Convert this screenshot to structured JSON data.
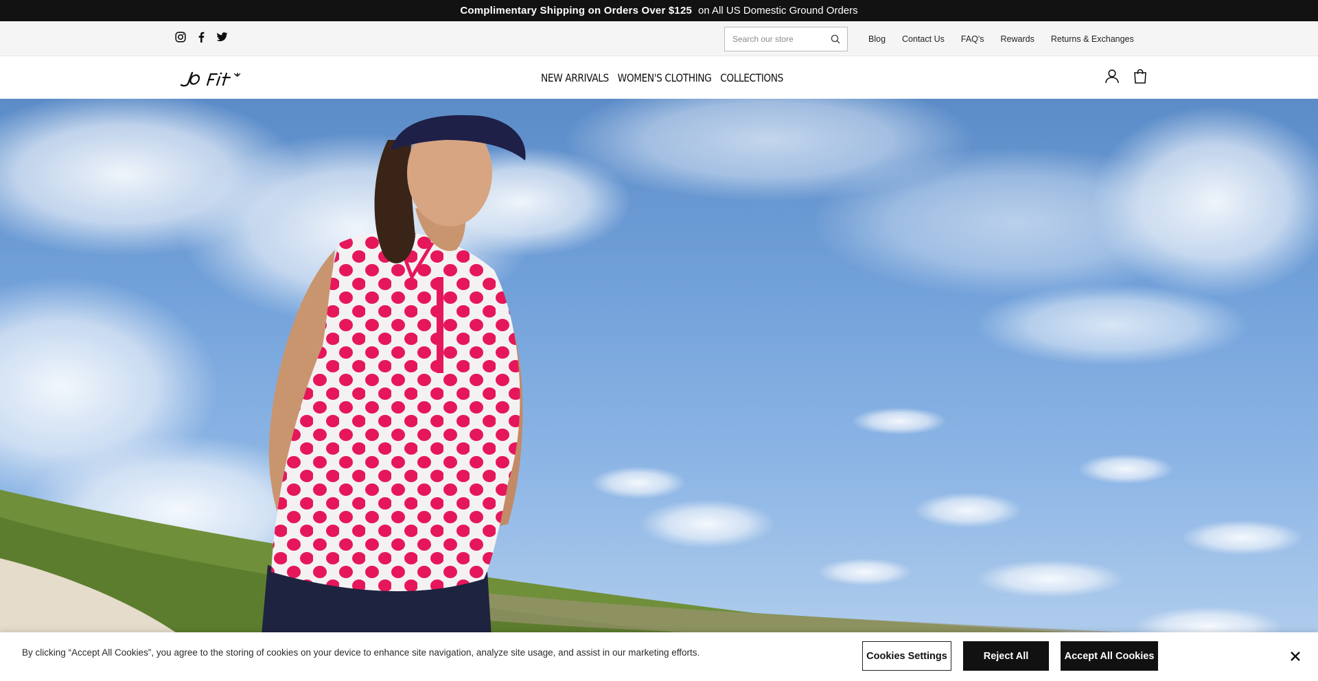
{
  "announcement": {
    "bold": "Complimentary Shipping on Orders Over $125",
    "rest": "on All US Domestic Ground Orders"
  },
  "social": {
    "icons": [
      "instagram-icon",
      "facebook-icon",
      "twitter-icon"
    ]
  },
  "search": {
    "placeholder": "Search our store"
  },
  "utility_links": [
    "Blog",
    "Contact Us",
    "FAQ's",
    "Rewards",
    "Returns & Exchanges"
  ],
  "brand": {
    "logo_text": "Jofit"
  },
  "main_nav": [
    "NEW ARRIVALS",
    "WOMEN'S CLOTHING",
    "COLLECTIONS"
  ],
  "header_icons": [
    "account-icon",
    "cart-icon"
  ],
  "cookie": {
    "text": "By clicking “Accept All Cookies”, you agree to the storing of cookies on your device to enhance site navigation, analyze site usage, and assist in our marketing efforts.",
    "settings_label": "Cookies Settings",
    "reject_label": "Reject All",
    "accept_label": "Accept All Cookies"
  },
  "colors": {
    "announcement_bg": "#121212",
    "utility_bg": "#f5f5f5",
    "polka_dot": "#e5175a",
    "sky": "#74a3db"
  }
}
